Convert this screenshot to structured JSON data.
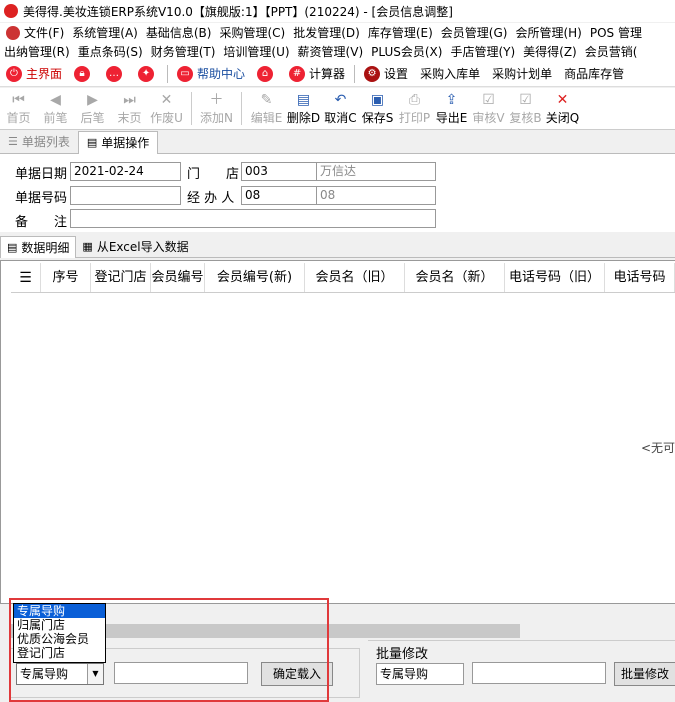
{
  "window": {
    "title": "美得得.美妆连锁ERP系统V10.0【旗舰版:1】【PPT】(210224) - [会员信息调整]"
  },
  "menu_row1": [
    "文件(F)",
    "系统管理(A)",
    "基础信息(B)",
    "采购管理(C)",
    "批发管理(D)",
    "库存管理(E)",
    "会员管理(G)",
    "会所管理(H)",
    "POS 管理"
  ],
  "menu_row2": [
    "出纳管理(R)",
    "重点条码(S)",
    "财务管理(T)",
    "培训管理(U)",
    "薪资管理(V)",
    "PLUS会员(X)",
    "手店管理(Y)",
    "美得得(Z)",
    "会员营销("
  ],
  "quickbar": {
    "home": "主界面",
    "help": "帮助中心",
    "calculator": "计算器",
    "settings": "设置",
    "purchase_in": "采购入库单",
    "purchase_plan": "采购计划单",
    "stock": "商品库存管"
  },
  "toolbar": [
    {
      "label": "首页",
      "glyph": "⏮",
      "enabled": false
    },
    {
      "label": "前笔",
      "glyph": "◀",
      "enabled": false
    },
    {
      "label": "后笔",
      "glyph": "▶",
      "enabled": false
    },
    {
      "label": "末页",
      "glyph": "⏭",
      "enabled": false
    },
    {
      "label": "作废U",
      "glyph": "✕",
      "enabled": false
    },
    {
      "label": "添加N",
      "glyph": "＋",
      "enabled": false
    },
    {
      "label": "编辑E",
      "glyph": "✎",
      "enabled": false
    },
    {
      "label": "删除D",
      "glyph": "▤",
      "enabled": true
    },
    {
      "label": "取消C",
      "glyph": "↶",
      "enabled": true
    },
    {
      "label": "保存S",
      "glyph": "▣",
      "enabled": true
    },
    {
      "label": "打印P",
      "glyph": "⎙",
      "enabled": false
    },
    {
      "label": "导出E",
      "glyph": "⇪",
      "enabled": true
    },
    {
      "label": "审核V",
      "glyph": "☑",
      "enabled": false
    },
    {
      "label": "复核B",
      "glyph": "☑",
      "enabled": false
    },
    {
      "label": "关闭Q",
      "glyph": "✕",
      "enabled": true
    }
  ],
  "tabs": {
    "list": "单据列表",
    "operation": "单据操作"
  },
  "form": {
    "date_label": "单据日期",
    "date_value": "2021-02-24",
    "store_label": "门　　店",
    "store_code": "003",
    "store_name": "万信达",
    "doc_no_label": "单据号码",
    "doc_no_value": "",
    "handler_label": "经 办 人",
    "handler_code": "08",
    "handler_name": "08",
    "remark_label": "备　　注",
    "remark_value": ""
  },
  "subtabs": {
    "detail": "数据明细",
    "import": "从Excel导入数据"
  },
  "grid": {
    "columns": [
      "序号",
      "登记门店",
      "会员编号",
      "会员编号(新)",
      "会员名（旧）",
      "会员名（新）",
      "电话号码（旧）",
      "电话号码"
    ],
    "empty_text": "<无可"
  },
  "dropdown": {
    "options": [
      "专属导购",
      "归属门店",
      "优质公海会员",
      "登记门店"
    ],
    "selected": "专属导购"
  },
  "bottom": {
    "load_button": "确定载入",
    "batch_title": "批量修改",
    "batch_field": "专属导购",
    "batch_button": "批量修改"
  },
  "colors": {
    "highlight_box": "#e0393b",
    "selected_option": "#0a5fd7"
  }
}
